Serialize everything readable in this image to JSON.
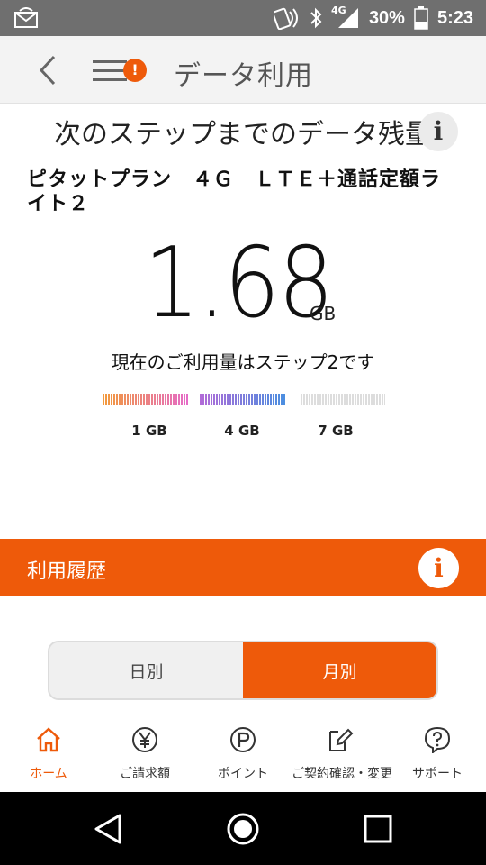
{
  "status_bar": {
    "network": "4G",
    "battery_percent": "30%",
    "time": "5:23",
    "icons": [
      "notification-icon",
      "nfc-icon",
      "bluetooth-icon",
      "signal-icon",
      "battery-icon"
    ]
  },
  "header": {
    "title": "データ利用",
    "menu_badge": "!"
  },
  "data_remaining": {
    "title": "次のステップまでのデータ残量",
    "info_label": "i",
    "plan_name": "ピタットプラン　４Ｇ　ＬＴＥ＋通話定額ライト２",
    "amount": "1.68",
    "unit": "GB",
    "step_message": "現在のご利用量はステップ2です",
    "steps": [
      {
        "label": "1 GB",
        "fill": 1.0,
        "color_start": "#f29a3a",
        "color_end": "#e56ac9"
      },
      {
        "label": "4 GB",
        "fill": 1.0,
        "color_start": "#b26ad8",
        "color_end": "#4a8fe0"
      },
      {
        "label": "7 GB",
        "fill": 0.0,
        "color_start": "#dddddd",
        "color_end": "#dddddd"
      }
    ]
  },
  "history": {
    "title": "利用履歴",
    "info_label": "i",
    "toggle": [
      {
        "label": "日別",
        "selected": false
      },
      {
        "label": "月別",
        "selected": true
      }
    ]
  },
  "bottom_nav": [
    {
      "label": "ホーム",
      "icon": "home-icon",
      "active": true
    },
    {
      "label": "ご請求額",
      "icon": "yen-icon",
      "active": false
    },
    {
      "label": "ポイント",
      "icon": "point-icon",
      "active": false
    },
    {
      "label": "ご契約確認・変更",
      "icon": "contract-edit-icon",
      "active": false
    },
    {
      "label": "サポート",
      "icon": "help-icon",
      "active": false
    }
  ],
  "colors": {
    "accent": "#ee5a0a",
    "status_bar": "#6f6f6f",
    "header_bg": "#f3f3f3"
  }
}
